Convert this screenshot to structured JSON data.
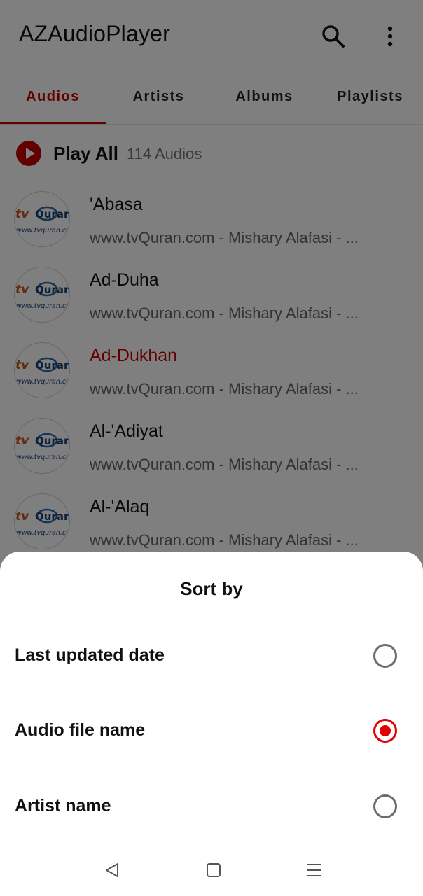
{
  "app": {
    "title": "AZAudioPlayer"
  },
  "header": {
    "search_icon": "search-icon",
    "more_icon": "more-vert-icon"
  },
  "tabs": [
    {
      "label": "Audios",
      "active": true
    },
    {
      "label": "Artists",
      "active": false
    },
    {
      "label": "Albums",
      "active": false
    },
    {
      "label": "Playlists",
      "active": false
    }
  ],
  "play_all": {
    "label": "Play All",
    "count": "114 Audios",
    "icon": "play-circle-icon"
  },
  "audios": [
    {
      "title": "'Abasa",
      "subtitle": "www.tvQuran.com - Mishary Alafasi - ...",
      "playing": false
    },
    {
      "title": "Ad-Duha",
      "subtitle": "www.tvQuran.com - Mishary Alafasi - ...",
      "playing": false
    },
    {
      "title": "Ad-Dukhan",
      "subtitle": "www.tvQuran.com - Mishary Alafasi - ...",
      "playing": true
    },
    {
      "title": "Al-'Adiyat",
      "subtitle": "www.tvQuran.com - Mishary Alafasi - ...",
      "playing": false
    },
    {
      "title": "Al-'Alaq",
      "subtitle": "www.tvQuran.com - Mishary Alafasi - ...",
      "playing": false
    }
  ],
  "thumb_logo": {
    "line1_a": "tv",
    "line1_b": "Quran",
    "line2": "www.tvquran.com"
  },
  "sort_sheet": {
    "title": "Sort by",
    "options": [
      {
        "label": "Last updated date",
        "selected": false
      },
      {
        "label": "Audio file name",
        "selected": true
      },
      {
        "label": "Artist name",
        "selected": false
      }
    ]
  },
  "colors": {
    "accent": "#c40000",
    "radio_selected": "#e00000",
    "scrim": "rgba(0,0,0,0.5)"
  },
  "system_nav": {
    "back_icon": "back-triangle-icon",
    "home_icon": "home-square-icon",
    "menu_icon": "menu-lines-icon"
  }
}
